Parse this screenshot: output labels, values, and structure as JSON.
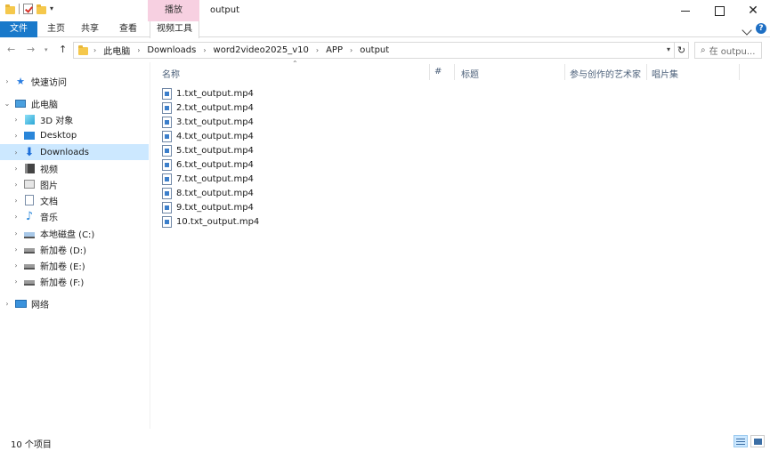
{
  "window": {
    "title": "output",
    "context_tab_header": "播放"
  },
  "ribbon": {
    "tabs": [
      "文件",
      "主页",
      "共享",
      "查看",
      "视频工具"
    ]
  },
  "address": {
    "crumbs": [
      "此电脑",
      "Downloads",
      "word2video2025_v10",
      "APP",
      "output"
    ]
  },
  "search": {
    "placeholder": "在 outpu..."
  },
  "nav": {
    "quick_access": "快速访问",
    "this_pc": "此电脑",
    "items": [
      "3D 对象",
      "Desktop",
      "Downloads",
      "视频",
      "图片",
      "文档",
      "音乐",
      "本地磁盘 (C:)",
      "新加卷 (D:)",
      "新加卷 (E:)",
      "新加卷 (F:)"
    ],
    "network": "网络",
    "selected": "Downloads"
  },
  "columns": {
    "name": "名称",
    "number": "#",
    "title": "标题",
    "artists": "参与创作的艺术家",
    "album": "唱片集"
  },
  "files": [
    "1.txt_output.mp4",
    "2.txt_output.mp4",
    "3.txt_output.mp4",
    "4.txt_output.mp4",
    "5.txt_output.mp4",
    "6.txt_output.mp4",
    "7.txt_output.mp4",
    "8.txt_output.mp4",
    "9.txt_output.mp4",
    "10.txt_output.mp4"
  ],
  "status": {
    "count": "10 个项目"
  },
  "colors": {
    "accent": "#1979ca",
    "selection": "#cce8ff",
    "context_tab": "#f7d0e1"
  }
}
